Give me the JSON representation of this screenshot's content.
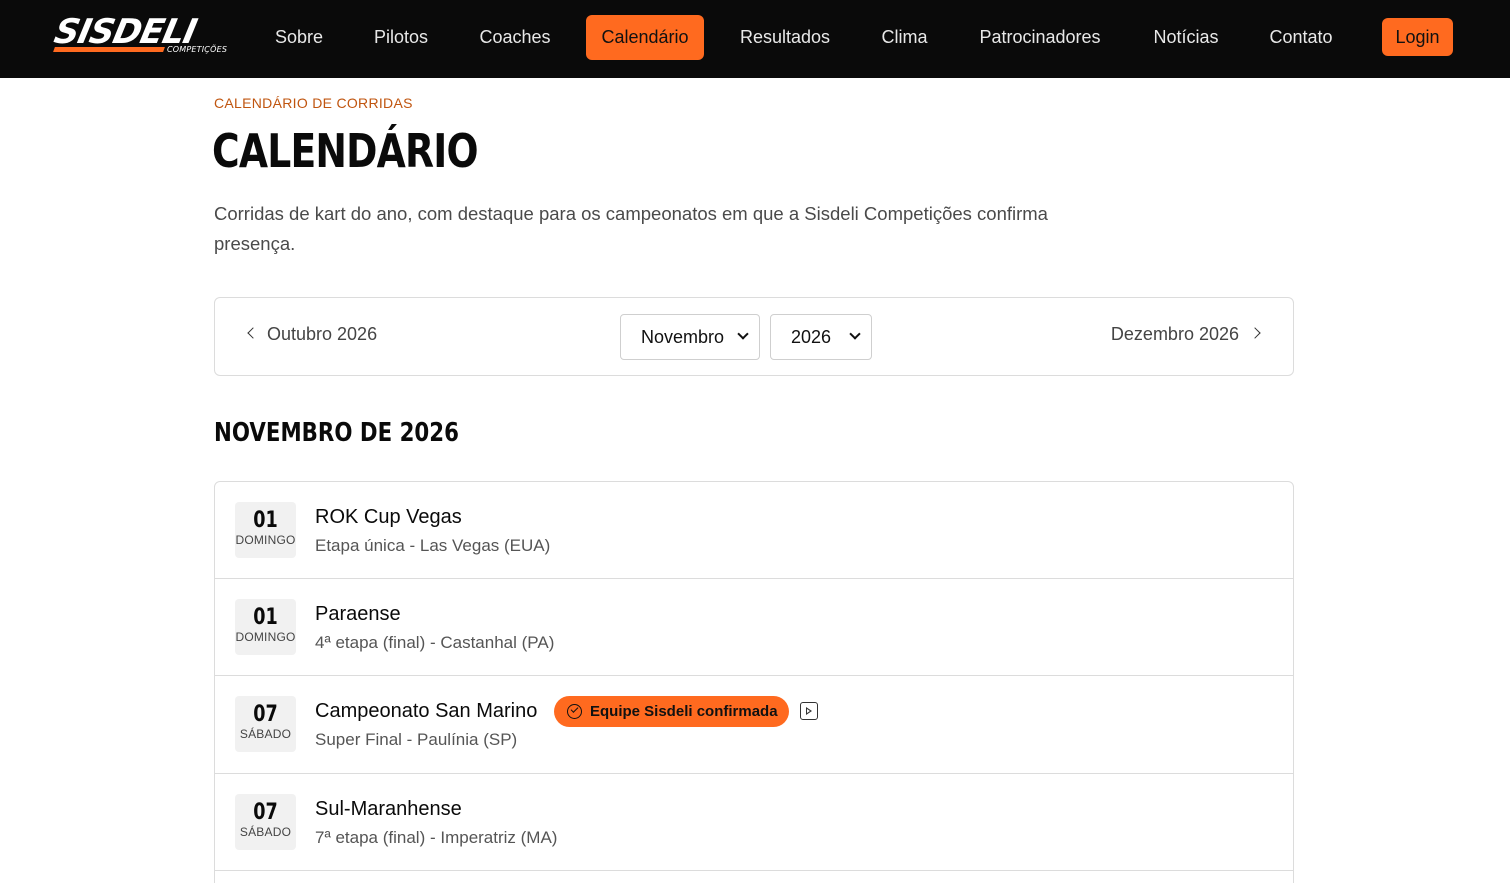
{
  "brand": {
    "name": "SISDELI",
    "tagline": "COMPETIÇÕES",
    "accent_color": "#ff6a1f"
  },
  "nav": {
    "items": [
      {
        "label": "Sobre",
        "active": false
      },
      {
        "label": "Pilotos",
        "active": false
      },
      {
        "label": "Coaches",
        "active": false
      },
      {
        "label": "Calendário",
        "active": true
      },
      {
        "label": "Resultados",
        "active": false
      },
      {
        "label": "Clima",
        "active": false
      },
      {
        "label": "Patrocinadores",
        "active": false
      },
      {
        "label": "Notícias",
        "active": false
      },
      {
        "label": "Contato",
        "active": false
      }
    ],
    "login_label": "Login"
  },
  "header": {
    "eyebrow": "CALENDÁRIO DE CORRIDAS",
    "title": "CALENDÁRIO",
    "intro": "Corridas de kart do ano, com destaque para os campeonatos em que a Sisdeli Competições confirma presença."
  },
  "month_nav": {
    "prev_label": "Outubro 2026",
    "next_label": "Dezembro 2026",
    "month_select": "Novembro",
    "year_select": "2026"
  },
  "month_heading": "NOVEMBRO DE 2026",
  "events": [
    {
      "day": "01",
      "weekday": "DOMINGO",
      "name": "ROK Cup Vegas",
      "detail": "Etapa única - Las Vegas (EUA)"
    },
    {
      "day": "01",
      "weekday": "DOMINGO",
      "name": "Paraense",
      "detail": "4ª etapa (final) - Castanhal (PA)"
    },
    {
      "day": "07",
      "weekday": "SÁBADO",
      "name": "Campeonato San Marino",
      "detail": "Super Final - Paulínia (SP)",
      "badge": "Equipe Sisdeli confirmada"
    },
    {
      "day": "07",
      "weekday": "SÁBADO",
      "name": "Sul-Maranhense",
      "detail": "7ª etapa (final) - Imperatriz (MA)"
    }
  ]
}
